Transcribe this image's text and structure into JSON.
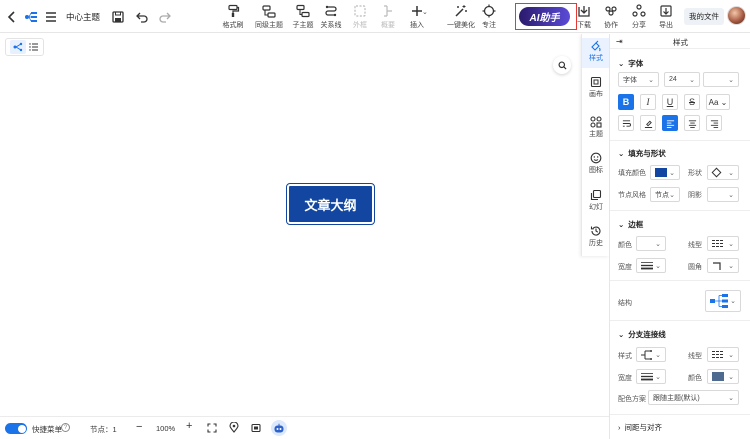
{
  "toolbar": {
    "title": "中心主题",
    "format_painter": "格式刷",
    "sibling_topic": "同级主题",
    "child_topic": "子主题",
    "relationship": "关系线",
    "outline_box": "外框",
    "summary": "概要",
    "insert": "插入",
    "beautify": "一键美化",
    "focus": "专注",
    "ai_assistant": "AI助手",
    "download": "下载",
    "collaborate": "协作",
    "share": "分享",
    "export": "导出",
    "my_files": "我的文件"
  },
  "canvas": {
    "central_topic": "文章大纲"
  },
  "side_tabs": [
    {
      "label": "样式",
      "icon": "style-icon"
    },
    {
      "label": "画布",
      "icon": "canvas-icon"
    },
    {
      "label": "主题",
      "icon": "theme-icon"
    },
    {
      "label": "图标",
      "icon": "emoji-icon"
    },
    {
      "label": "幻灯",
      "icon": "slides-icon"
    },
    {
      "label": "历史",
      "icon": "history-icon"
    }
  ],
  "panel": {
    "title": "样式",
    "font": {
      "section": "字体",
      "family": "字体",
      "size": "24",
      "color": ""
    },
    "fill": {
      "section": "填充与形状",
      "fill_color_label": "填充颜色",
      "fill_color": "#1246a0",
      "shape_label": "形状",
      "node_style_label": "节点风格",
      "node_style_value": "节点",
      "shadow_label": "阴影"
    },
    "border": {
      "section": "边框",
      "color_label": "颜色",
      "line_type_label": "线型",
      "width_label": "宽度",
      "corner_label": "圆角"
    },
    "structure": {
      "label": "结构"
    },
    "branch": {
      "section": "分支连接线",
      "style_label": "样式",
      "line_type_label": "线型",
      "width_label": "宽度",
      "color_label": "颜色",
      "color": "#4f6a8f",
      "scheme_label": "配色方案",
      "scheme_value": "跟随主题(默认)"
    },
    "align": {
      "section": "间距与对齐"
    }
  },
  "bottom": {
    "quick_menu": "快捷菜单",
    "nodes": "节点：1",
    "zoom": "100%"
  },
  "colors": {
    "accent": "#1a73e8",
    "ai_gradient_start": "#3a1c71",
    "ai_gradient_end": "#5b4bd8",
    "highlight_box": "#e53935"
  }
}
